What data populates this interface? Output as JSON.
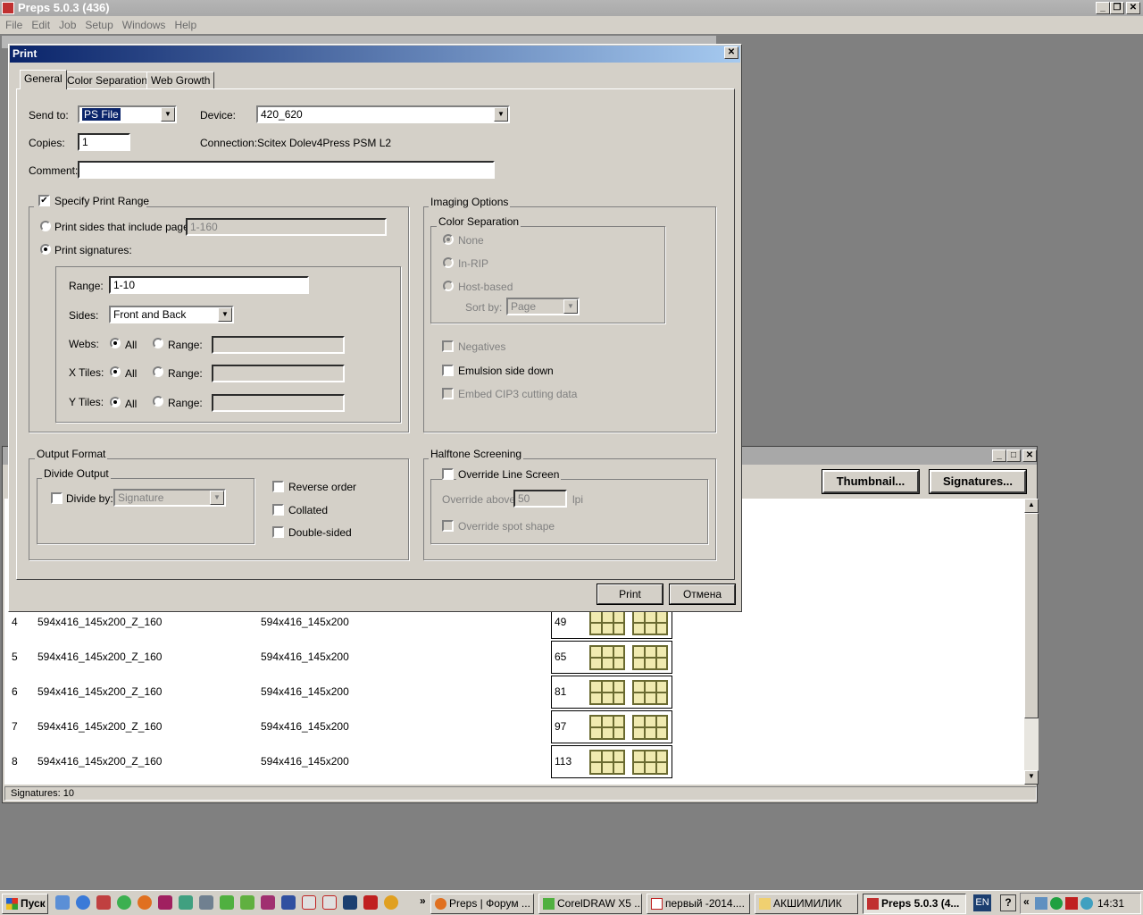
{
  "app": {
    "title": "Preps 5.0.3 (436)",
    "menu": [
      "File",
      "Edit",
      "Job",
      "Setup",
      "Windows",
      "Help"
    ]
  },
  "child": {
    "thumbnail_btn": "Thumbnail...",
    "signatures_btn": "Signatures...",
    "status": "Signatures: 10",
    "rows": [
      {
        "n": "4",
        "name": "594x416_145x200_Z_160",
        "tmpl": "594x416_145x200",
        "page": "49"
      },
      {
        "n": "5",
        "name": "594x416_145x200_Z_160",
        "tmpl": "594x416_145x200",
        "page": "65"
      },
      {
        "n": "6",
        "name": "594x416_145x200_Z_160",
        "tmpl": "594x416_145x200",
        "page": "81"
      },
      {
        "n": "7",
        "name": "594x416_145x200_Z_160",
        "tmpl": "594x416_145x200",
        "page": "97"
      },
      {
        "n": "8",
        "name": "594x416_145x200_Z_160",
        "tmpl": "594x416_145x200",
        "page": "113"
      }
    ]
  },
  "dialog": {
    "title": "Print",
    "tabs": [
      "General",
      "Color Separations",
      "Web Growth"
    ],
    "send_to_label": "Send to:",
    "send_to": "PS File",
    "device_label": "Device:",
    "device": "420_620",
    "copies_label": "Copies:",
    "copies": "1",
    "connection_label": "Connection:",
    "connection": "Scitex Dolev4Press PSM L2",
    "comment_label": "Comment:",
    "comment": "",
    "range_group": "Specify Print Range",
    "print_sides": "Print sides that include pages:",
    "print_sides_value": "1-160",
    "print_signatures": "Print signatures:",
    "range_label": "Range:",
    "range_value": "1-10",
    "sides_label": "Sides:",
    "sides_value": "Front and Back",
    "webs_label": "Webs:",
    "xtiles_label": "X Tiles:",
    "ytiles_label": "Y Tiles:",
    "all": "All",
    "range": "Range:",
    "imaging_group": "Imaging Options",
    "colorsep_group": "Color Separation",
    "none": "None",
    "inrip": "In-RIP",
    "hostbased": "Host-based",
    "sortby_label": "Sort by:",
    "sortby_value": "Page",
    "negatives": "Negatives",
    "emulsion": "Emulsion side down",
    "embed": "Embed CIP3 cutting data",
    "output_group": "Output Format",
    "divide_group": "Divide Output",
    "divide_by": "Divide by:",
    "divide_value": "Signature",
    "reverse": "Reverse order",
    "collated": "Collated",
    "double_sided": "Double-sided",
    "halftone_group": "Halftone Screening",
    "override_ls": "Override Line Screen",
    "override_above": "Override above:",
    "override_value": "50",
    "lpi": "lpi",
    "override_spot": "Override spot shape",
    "print_btn": "Print",
    "cancel_btn": "Отмена"
  },
  "taskbar": {
    "start": "Пуск",
    "items": [
      "Preps | Форум ...",
      "CorelDRAW X5 ...",
      "первый -2014....",
      "АКШИМИЛИК",
      "Preps 5.0.3 (4..."
    ],
    "lang": "EN",
    "time": "14:31"
  }
}
